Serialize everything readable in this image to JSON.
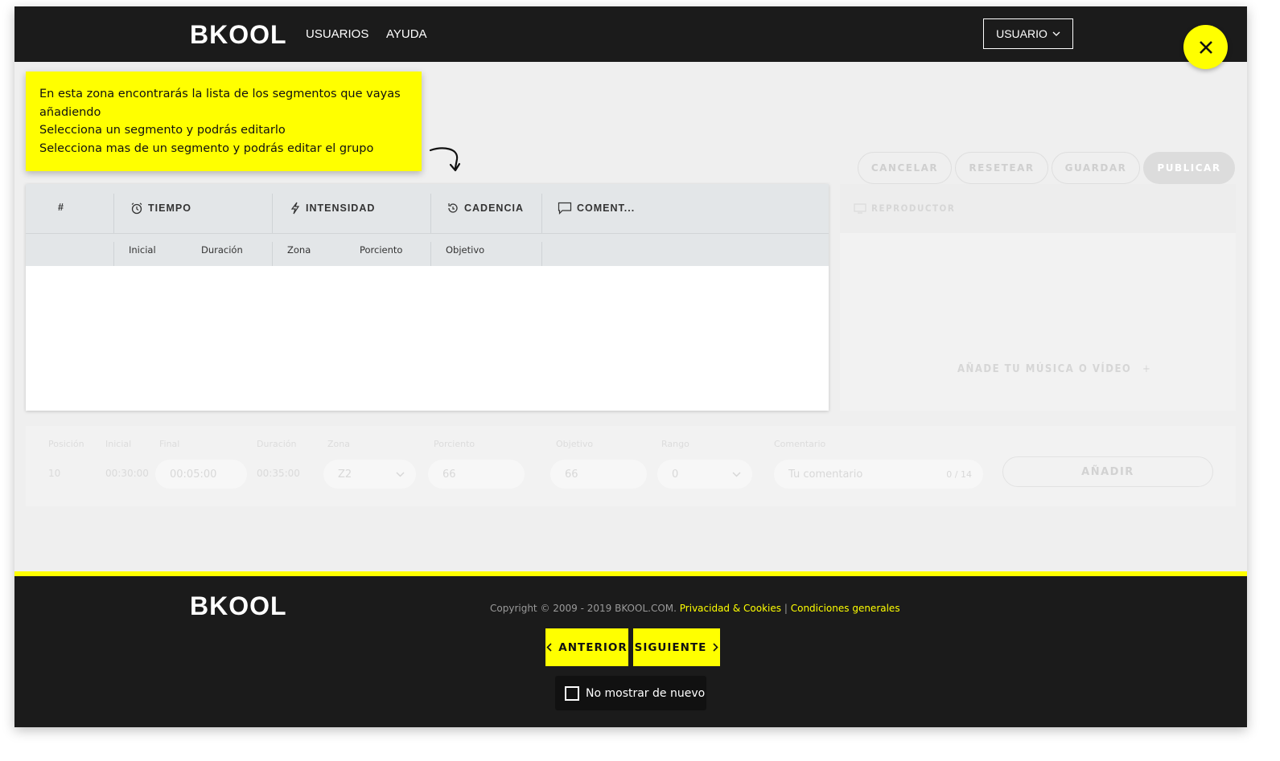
{
  "header": {
    "logo": "BKOOL",
    "nav": [
      "USUARIOS",
      "AYUDA"
    ],
    "user_label": "USUARIO"
  },
  "tooltip": {
    "lines": [
      "En esta zona encontrarás la lista de los segmentos que vayas",
      "añadiendo",
      "Selecciona un segmento y podrás editarlo",
      "Selecciona mas de un segmento y podrás editar el grupo"
    ]
  },
  "actions": {
    "cancel": "CANCELAR",
    "reset": "RESETEAR",
    "save": "GUARDAR",
    "publish": "PUBLICAR"
  },
  "table": {
    "headers": {
      "index": "#",
      "time": "TIEMPO",
      "intensity": "INTENSIDAD",
      "cadence": "CADENCIA",
      "comment": "COMENT..."
    },
    "subheaders": [
      "Inicial",
      "Duración",
      "Zona",
      "Porciento",
      "Objetivo"
    ]
  },
  "player": {
    "title": "REPRODUCTOR",
    "add_media": "AÑADE TU MÚSICA O VÍDEO"
  },
  "form": {
    "labels": [
      "Posición",
      "Inicial",
      "Final",
      "Duración",
      "Zona",
      "Porciento",
      "Objetivo",
      "Rango",
      "Comentario"
    ],
    "position": "10",
    "initial": "00:30:00",
    "final": "00:05:00",
    "duration": "00:35:00",
    "zone": "Z2",
    "percent": "66",
    "target": "66",
    "range": "0",
    "comment_placeholder": "Tu comentario",
    "comment_count": "0 / 14",
    "add_button": "AÑADIR"
  },
  "footer": {
    "logo": "BKOOL",
    "copyright": "Copyright © 2009 - 2019 BKOOL.COM.",
    "privacy_link": "Privacidad & Cookies",
    "separator": "|",
    "terms_link": "Condiciones generales",
    "prev_button": "ANTERIOR",
    "next_button": "SIGUIENTE",
    "dont_show_label": "No mostrar de nuevo"
  },
  "colors": {
    "accent": "#ffff00",
    "dark": "#1b1b1b",
    "header_bg": "#e3e6e8"
  }
}
